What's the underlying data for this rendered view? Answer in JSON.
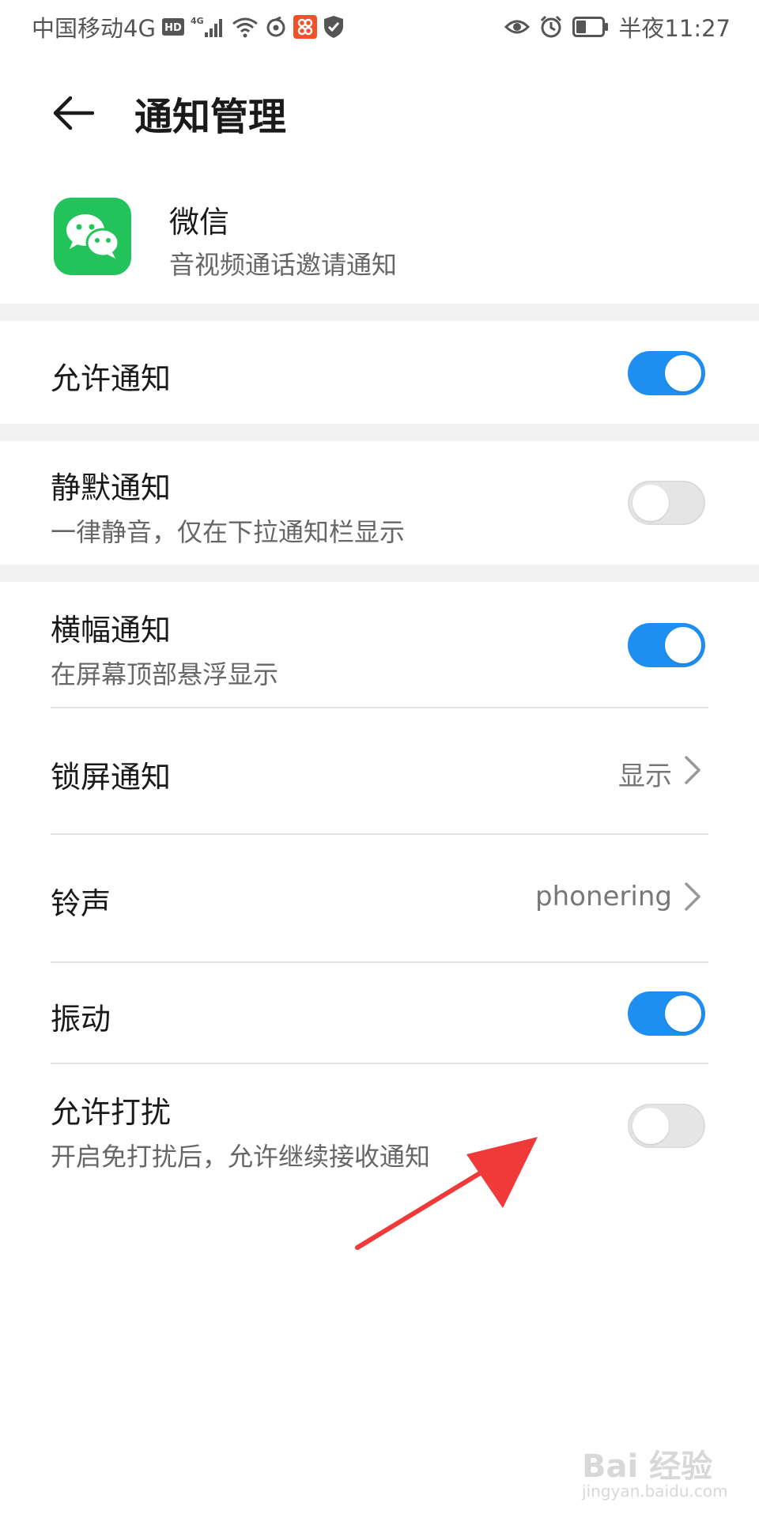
{
  "status_bar": {
    "carrier": "中国移动4G",
    "hd_badge": "HD",
    "network_badge": "4G",
    "time": "半夜11:27",
    "icons_left": [
      "hd-icon",
      "signal-icon",
      "wifi-icon",
      "netease-icon",
      "app-badge-icon",
      "shield-icon"
    ],
    "icons_right": [
      "eye-icon",
      "alarm-icon",
      "battery-icon"
    ]
  },
  "header": {
    "title": "通知管理",
    "back_icon": "back-arrow-icon"
  },
  "app": {
    "name": "微信",
    "subtitle": "音视频通话邀请通知",
    "icon": "wechat-icon",
    "icon_color": "#22c35b"
  },
  "settings": {
    "allow_notifications": {
      "title": "允许通知",
      "enabled": true
    },
    "silent_notifications": {
      "title": "静默通知",
      "subtitle": "一律静音，仅在下拉通知栏显示",
      "enabled": false
    },
    "banner_notifications": {
      "title": "横幅通知",
      "subtitle": "在屏幕顶部悬浮显示",
      "enabled": true
    },
    "lockscreen_notifications": {
      "title": "锁屏通知",
      "value": "显示"
    },
    "ringtone": {
      "title": "铃声",
      "value": "phonering"
    },
    "vibration": {
      "title": "振动",
      "enabled": true
    },
    "allow_disturb": {
      "title": "允许打扰",
      "subtitle": "开启免打扰后，允许继续接收通知",
      "enabled": false
    }
  },
  "colors": {
    "toggle_on": "#1e8ef0",
    "toggle_off": "#e5e5e5",
    "annotation_arrow": "#f03a3a"
  },
  "watermark": {
    "text": "Bai 经验",
    "url": "jingyan.baidu.com"
  }
}
